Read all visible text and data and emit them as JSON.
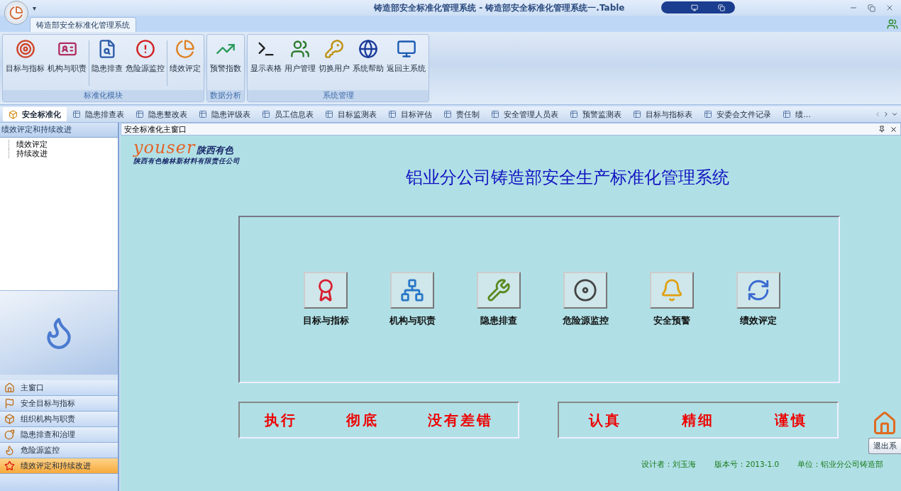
{
  "window": {
    "title": "铸造部安全标准化管理系统 - 铸造部安全标准化管理系统一.Table",
    "quick_access": "▾"
  },
  "ribbon": {
    "tabs": [
      {
        "label": "铸造部安全标准化管理系统",
        "selected": true
      }
    ],
    "groups": [
      {
        "label": "标准化模块",
        "buttons": [
          "目标与指标",
          "机构与职责",
          "隐患排查",
          "危险源监控",
          "绩效评定"
        ]
      },
      {
        "label": "数据分析",
        "buttons": [
          "预警指数"
        ]
      },
      {
        "label": "系统管理",
        "buttons": [
          "显示表格",
          "用户管理",
          "切换用户",
          "系统帮助",
          "返回主系统"
        ]
      }
    ]
  },
  "doc_tabs": [
    {
      "label": "安全标准化",
      "selected": true
    },
    {
      "label": "隐患排查表",
      "selected": false
    },
    {
      "label": "隐患整改表",
      "selected": false
    },
    {
      "label": "隐患评级表",
      "selected": false
    },
    {
      "label": "员工信息表",
      "selected": false
    },
    {
      "label": "目标监测表",
      "selected": false
    },
    {
      "label": "目标评估",
      "selected": false
    },
    {
      "label": "责任制",
      "selected": false
    },
    {
      "label": "安全管理人员表",
      "selected": false
    },
    {
      "label": "预警监测表",
      "selected": false
    },
    {
      "label": "目标与指标表",
      "selected": false
    },
    {
      "label": "安委会文件记录",
      "selected": false
    },
    {
      "label": "绩…",
      "selected": false
    }
  ],
  "sidebar": {
    "header": "绩效评定和持续改进",
    "tree": [
      {
        "label": "绩效评定"
      },
      {
        "label": "持续改进"
      }
    ],
    "nav": [
      {
        "label": "主窗口",
        "selected": false
      },
      {
        "label": "安全目标与指标",
        "selected": false
      },
      {
        "label": "组织机构与职责",
        "selected": false
      },
      {
        "label": "隐患排查和治理",
        "selected": false
      },
      {
        "label": "危险源监控",
        "selected": false
      },
      {
        "label": "绩效评定和持续改进",
        "selected": true
      }
    ]
  },
  "main": {
    "header": "安全标准化主窗口",
    "logo": {
      "brand": "youser",
      "brand_cn": "陕西有色",
      "company": "陕西有色榆林新材料有限责任公司"
    },
    "title": "铝业分公司铸造部安全生产标准化管理系统",
    "modules": [
      "目标与指标",
      "机构与职责",
      "隐患排查",
      "危险源监控",
      "安全预警",
      "绩效评定"
    ],
    "slogans": [
      [
        "执行",
        "彻底",
        "没有差错"
      ],
      [
        "认真",
        "精细",
        "谨慎"
      ]
    ],
    "exit_button": "退出系",
    "footer": [
      "设计者：刘玉海",
      "版本号：2013-1.0",
      "单位：铝业分公司铸造部"
    ]
  }
}
